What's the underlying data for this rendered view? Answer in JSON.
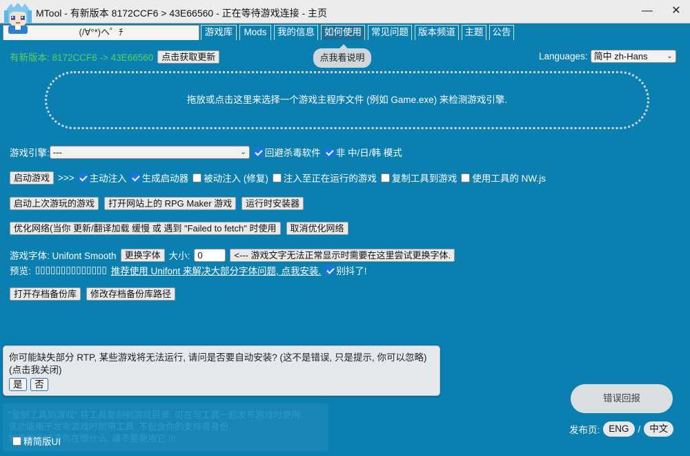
{
  "window": {
    "title": "MTool - 有新版本 8172CCF6 > 43E66560 - 正在等待游戏连接 - 主页",
    "minimize": "—",
    "close": "✕"
  },
  "tabs": {
    "home": "(/∀°*)ヘ゜ﾁ",
    "items": [
      "游戏库",
      "Mods",
      "我的信息",
      "如何使用",
      "常见问题",
      "版本频道",
      "主题",
      "公告"
    ]
  },
  "update": {
    "text": "有新版本: 8172CCF6 -> 43E66560",
    "button": "点击获取更新",
    "color": "#5dd05d"
  },
  "tooltip": "点我看说明",
  "language": {
    "label": "Languages:",
    "value": "简中 zh-Hans"
  },
  "dropzone": "拖放或点击这里来选择一个游戏主程序文件 (例如 Game.exe) 来检测游戏引擎.",
  "engine": {
    "label": "游戏引擎:",
    "value": "---",
    "avoid_av": "回避杀毒软件",
    "avoid_av_checked": true,
    "non_cjk": "非 中/日/韩 模式",
    "non_cjk_checked": true
  },
  "launch": {
    "button": "启动游戏",
    "arrows": ">>>",
    "options": [
      {
        "label": "主动注入",
        "checked": true
      },
      {
        "label": "生成启动器",
        "checked": true
      },
      {
        "label": "被动注入 (修复)",
        "checked": false
      },
      {
        "label": "注入至正在运行的游戏",
        "checked": false
      },
      {
        "label": "复制工具到游戏",
        "checked": false
      },
      {
        "label": "使用工具的 NW.js",
        "checked": false
      }
    ]
  },
  "row3": {
    "last_game": "启动上次游玩的游戏",
    "rpg_maker": "打开网站上的 RPG Maker 游戏",
    "runtime": "运行时安装器"
  },
  "network": {
    "optimize": "优化网络(当你 更新/翻译加载 缓慢 或 遇到 \"Failed to fetch\" 时使用",
    "cancel": "取消优化网络"
  },
  "font": {
    "label": "游戏字体: Unifont Smooth",
    "change": "更换字体",
    "size_label": "大小:",
    "size_value": "0",
    "hint": "<--- 游戏文字无法正常显示时需要在这里尝试更换字体.",
    "preview_label": "预览:",
    "preview_boxes": "▯▯▯▯▯▯▯▯▯▯▯▯▯▯",
    "recommend": "推荐使用 Unifont 来解决大部分字体问题, 点我安装.",
    "shake": "别抖了!",
    "shake_checked": true
  },
  "backup": {
    "open": "打开存档备份库",
    "change_path": "修改存档备份库路径"
  },
  "notice": {
    "text": "你可能缺失部分 RTP, 某些游戏将无法运行, 请问是否要自动安装? (这不是错误, 只是提示, 你可以忽略)",
    "sub": "(点击我关闭)",
    "yes": "是",
    "no": "否"
  },
  "faded_note": {
    "line1": "\"复制工具到游戏\" 将工具复制到游戏目录, 可在与工具一起发布游戏时使用.",
    "line2": "该功能用于发布游戏时附带工具, 不包含你的支持者身份.",
    "line3": "如果你不知道你在做什么, 请不要使用它 !!!"
  },
  "compact": {
    "label": "精简版UI",
    "checked": false
  },
  "report": "错误回报",
  "release": {
    "label": "发布页:",
    "eng": "ENG",
    "sep": "/",
    "zh": "中文"
  }
}
